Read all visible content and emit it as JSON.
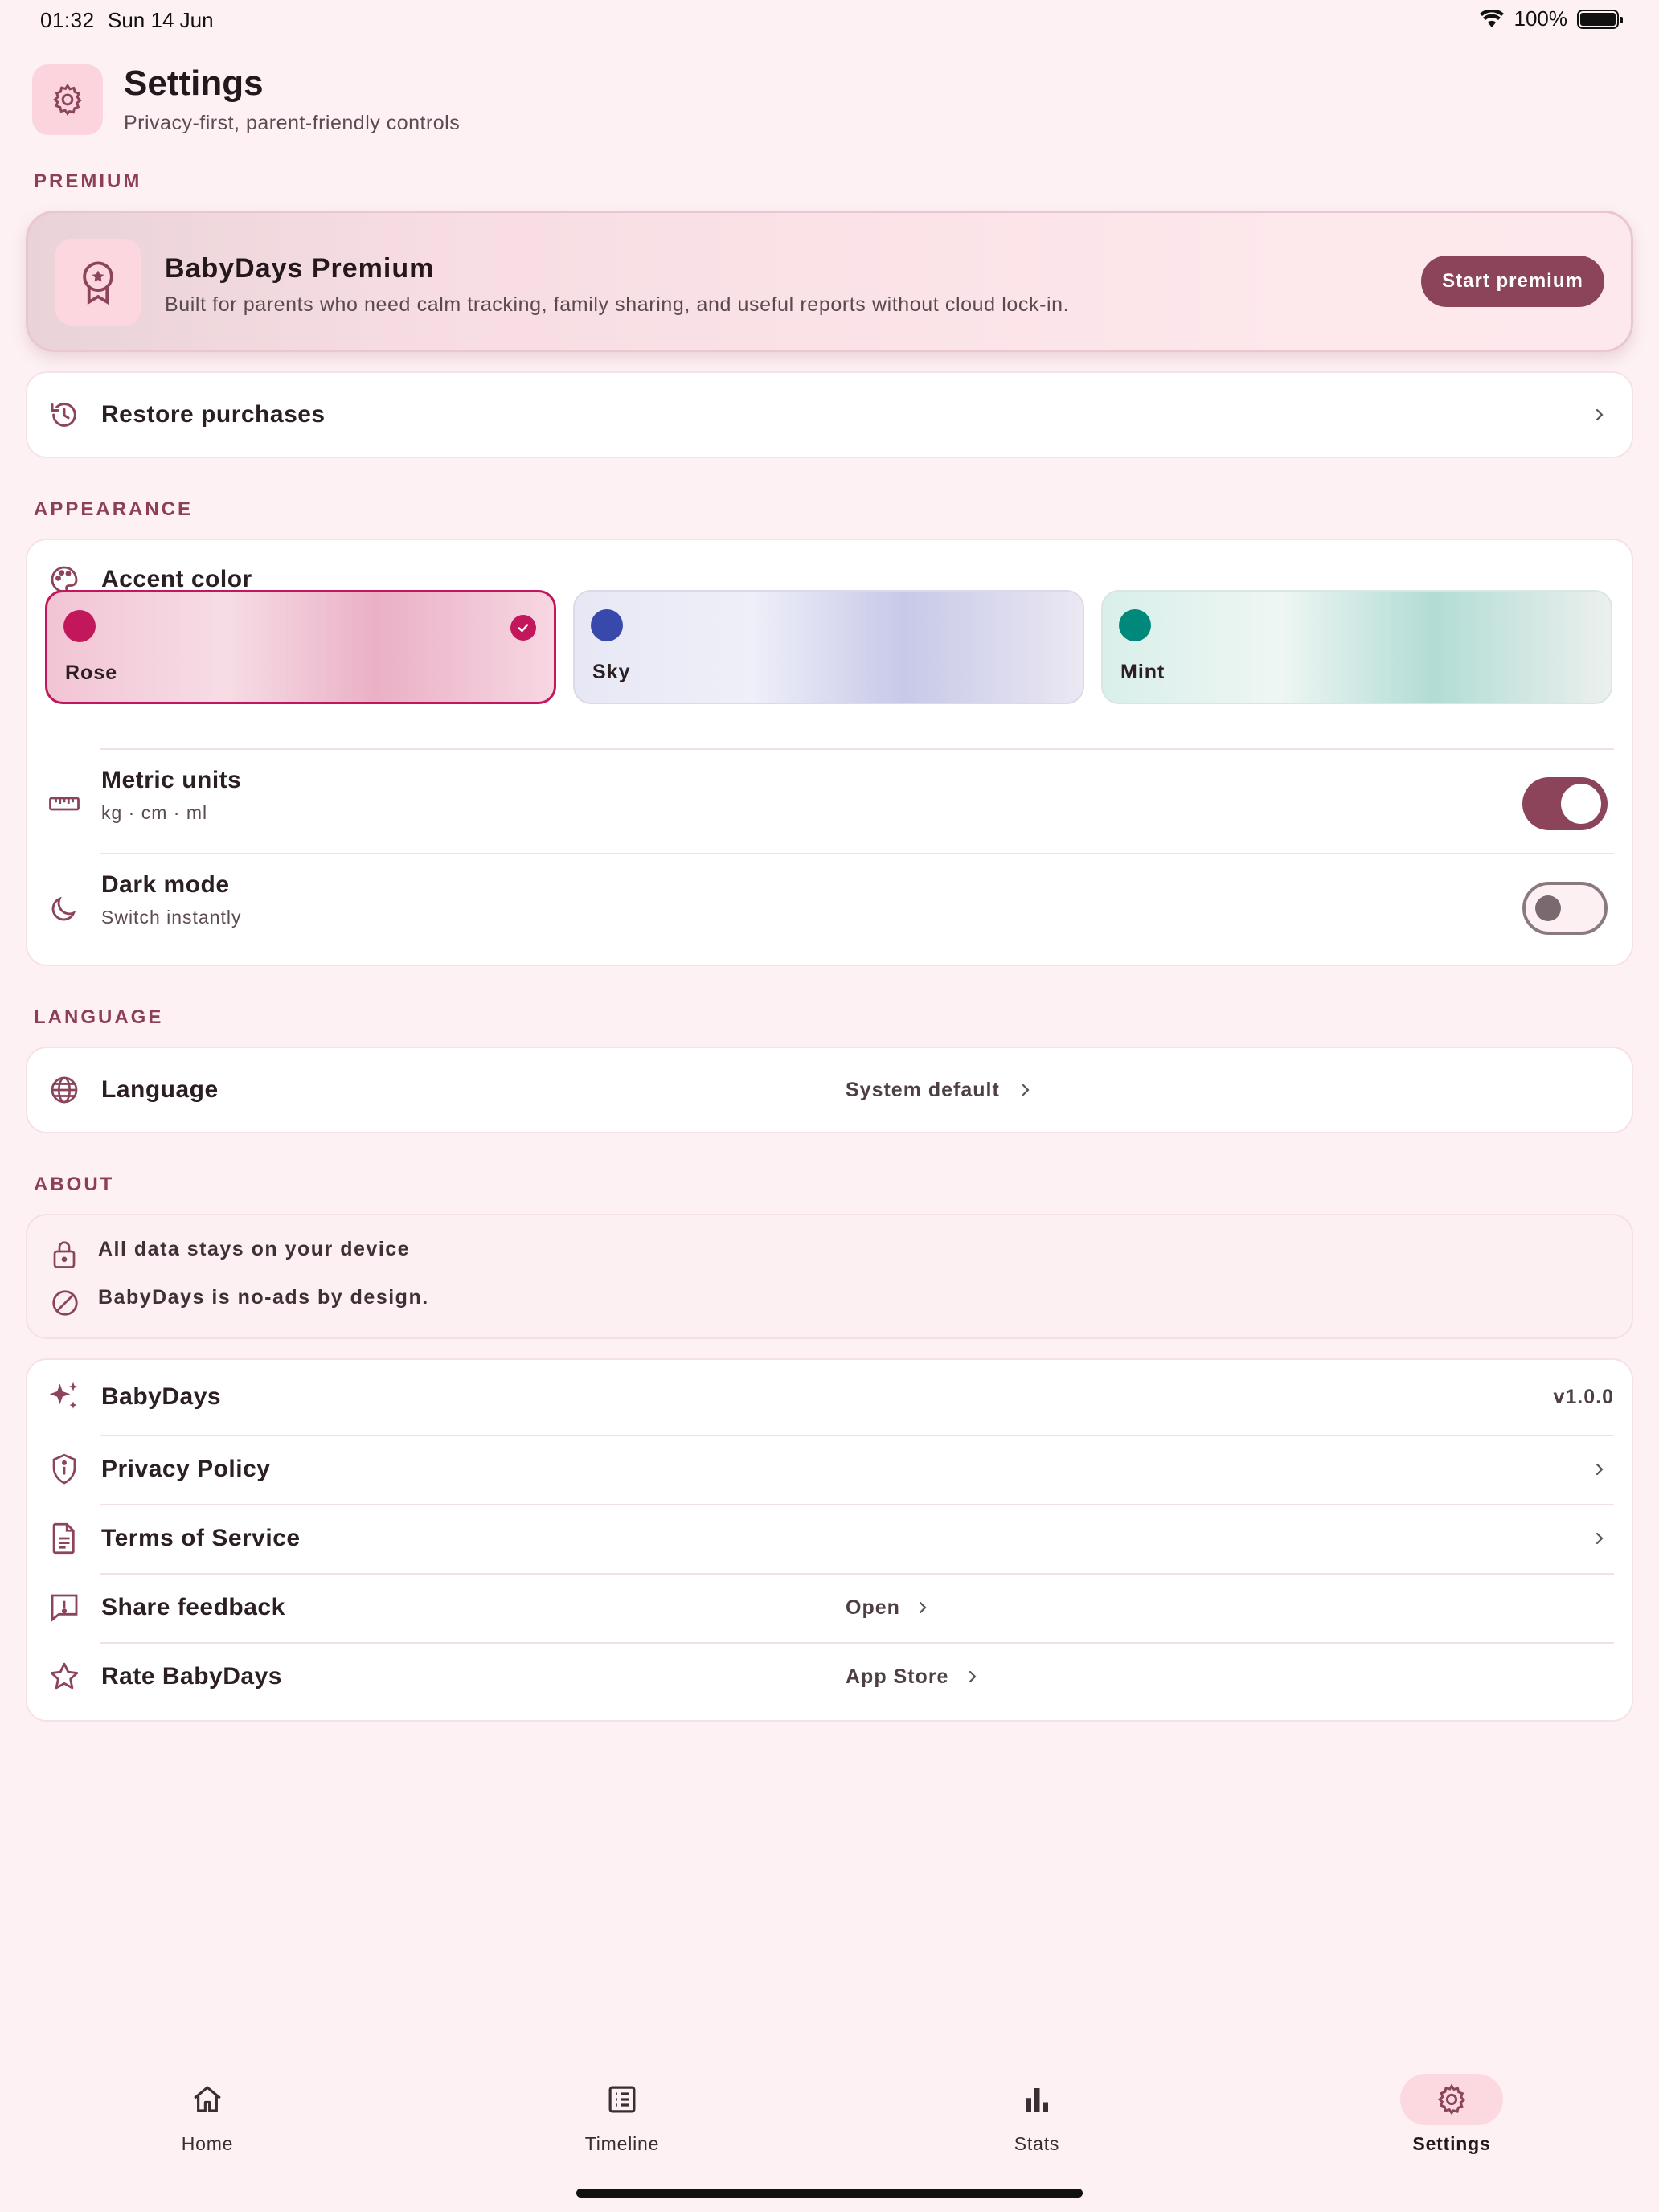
{
  "status_bar": {
    "time": "01:32",
    "date": "Sun 14 Jun",
    "battery": "100%"
  },
  "header": {
    "title": "Settings",
    "subtitle": "Privacy-first, parent-friendly controls",
    "icon": "gear-icon"
  },
  "sections": {
    "premium": "PREMIUM",
    "appearance": "APPEARANCE",
    "language": "LANGUAGE",
    "about": "ABOUT"
  },
  "premium": {
    "title": "BabyDays Premium",
    "description": "Built for parents who need calm tracking, family sharing, and useful reports without cloud lock-in.",
    "button": "Start premium",
    "icon": "award-badge-icon"
  },
  "restore": {
    "label": "Restore purchases",
    "icon": "history-icon"
  },
  "appearance": {
    "accent_label": "Accent color",
    "swatches": [
      {
        "name": "Rose",
        "color": "#c2185b",
        "selected": true
      },
      {
        "name": "Sky",
        "color": "#3949ab",
        "selected": false
      },
      {
        "name": "Mint",
        "color": "#00897b",
        "selected": false
      }
    ],
    "metric": {
      "label": "Metric units",
      "sub": "kg · cm · ml",
      "enabled": true
    },
    "dark": {
      "label": "Dark mode",
      "sub": "Switch instantly",
      "enabled": false
    }
  },
  "language": {
    "label": "Language",
    "value": "System default",
    "icon": "globe-icon"
  },
  "about": {
    "lines": [
      "All data stays on your device",
      "BabyDays is no-ads by design."
    ]
  },
  "links": {
    "app": {
      "label": "BabyDays",
      "value": "v1.0.0"
    },
    "privacy": {
      "label": "Privacy Policy"
    },
    "terms": {
      "label": "Terms of Service"
    },
    "feedback": {
      "label": "Share feedback",
      "value": "Open"
    },
    "rate": {
      "label": "Rate BabyDays",
      "value": "App Store"
    }
  },
  "tabs": [
    {
      "label": "Home",
      "icon": "home-icon",
      "active": false
    },
    {
      "label": "Timeline",
      "icon": "list-icon",
      "active": false
    },
    {
      "label": "Stats",
      "icon": "bar-chart-icon",
      "active": false
    },
    {
      "label": "Settings",
      "icon": "gear-icon",
      "active": true
    }
  ],
  "colors": {
    "accent": "#8b4459",
    "background": "#fdf1f4",
    "section_label": "#8d3f57"
  }
}
